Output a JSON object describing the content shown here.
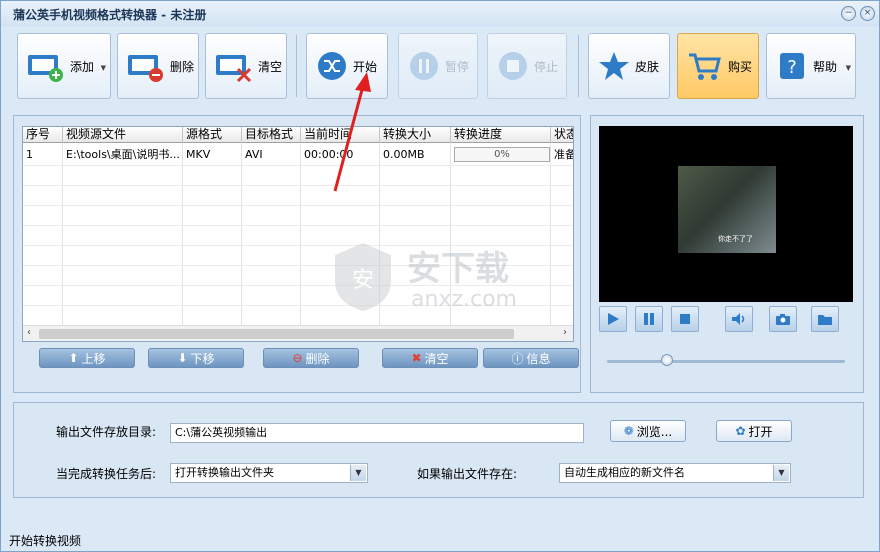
{
  "window": {
    "title": "蒲公英手机视频格式转换器 - 未注册",
    "minimize_glyph": "−",
    "close_glyph": "×"
  },
  "toolbar": {
    "add": "添加",
    "delete": "删除",
    "clear": "清空",
    "start": "开始",
    "pause": "暂停",
    "stop": "停止",
    "skin": "皮肤",
    "buy": "购买",
    "help": "帮助"
  },
  "table": {
    "headers": [
      "序号",
      "视频源文件",
      "源格式",
      "目标格式",
      "当前时间",
      "转换大小",
      "转换进度",
      "状态"
    ],
    "rows": [
      {
        "index": "1",
        "source": "E:\\tools\\桌面\\说明书...",
        "src_format": "MKV",
        "dst_format": "AVI",
        "time": "00:00:00",
        "size": "0.00MB",
        "progress": "0%",
        "status": "准备"
      }
    ]
  },
  "list_buttons": {
    "up": "上移",
    "down": "下移",
    "delete": "删除",
    "clear": "清空",
    "info": "信息"
  },
  "output": {
    "dir_label": "输出文件存放目录:",
    "dir_value": "C:\\蒲公英视频输出",
    "browse": "浏览...",
    "open": "打开",
    "after_label": "当完成转换任务后:",
    "after_value": "打开转换输出文件夹",
    "exists_label": "如果输出文件存在:",
    "exists_value": "自动生成相应的新文件名"
  },
  "status": {
    "text": "开始转换视频"
  },
  "watermark": {
    "text": "安下载",
    "domain": "anxz.com"
  },
  "video": {
    "subtitle": "你走不了了"
  },
  "colors": {
    "accent": "#3f7fc0",
    "arrow": "#e02020",
    "buy_bg": "#ffc964"
  }
}
